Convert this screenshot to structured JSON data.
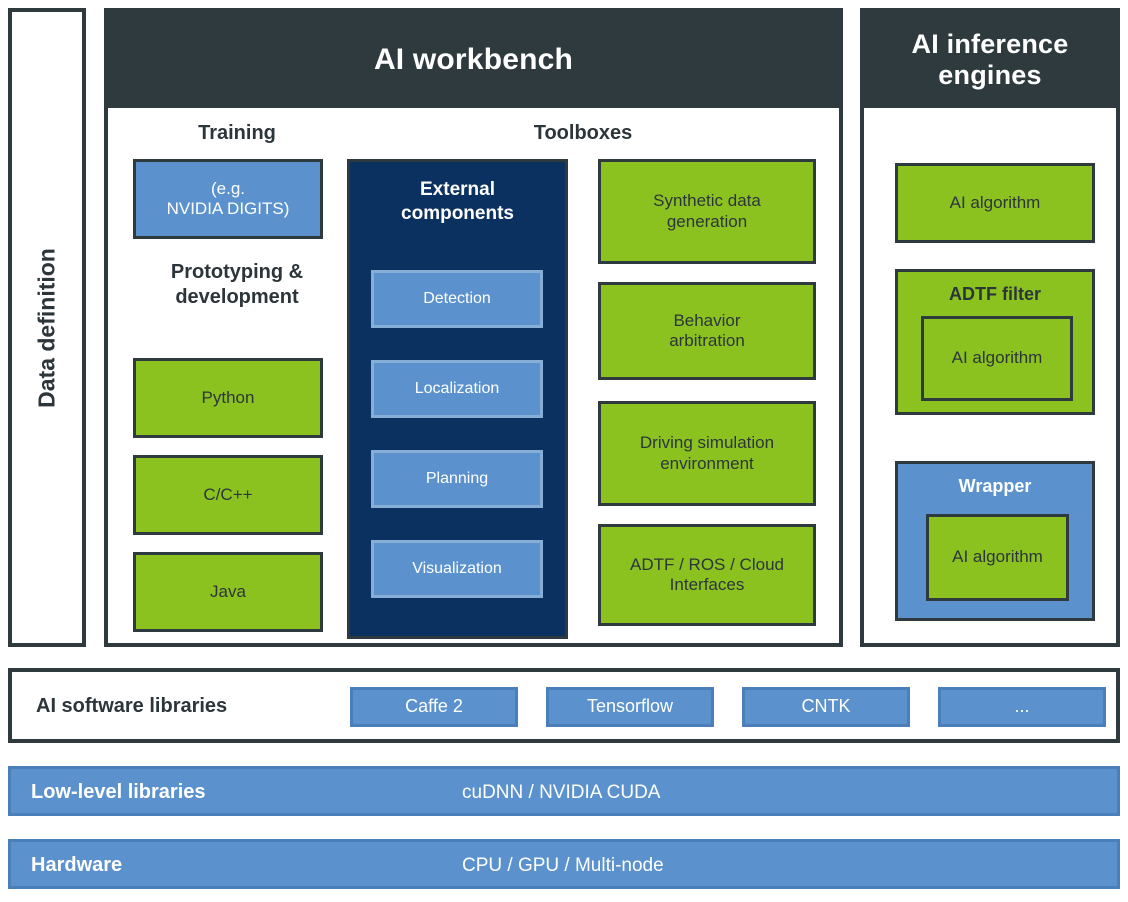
{
  "colors": {
    "dark": "#2e3a3e",
    "navy": "#0b3161",
    "blue": "#5b92ce",
    "green": "#8cc220",
    "white": "#ffffff"
  },
  "data_definition": {
    "label": "Data definition"
  },
  "workbench": {
    "title": "AI workbench",
    "training": {
      "title": "Training",
      "framework_box": "(e.g.\nNVIDIA DIGITS)",
      "framework_line1": "(e.g.",
      "framework_line2": "NVIDIA DIGITS)",
      "prototyping_title_line1": "Prototyping &",
      "prototyping_title_line2": "development",
      "languages": [
        "Python",
        "C/C++",
        "Java"
      ]
    },
    "toolboxes": {
      "title": "Toolboxes",
      "external_components": {
        "title_line1": "External",
        "title_line2": "components",
        "items": [
          "Detection",
          "Localization",
          "Planning",
          "Visualization"
        ]
      },
      "modules": [
        {
          "line1": "Synthetic data",
          "line2": "generation"
        },
        {
          "line1": "Behavior",
          "line2": "arbitration"
        },
        {
          "line1": "Driving simulation",
          "line2": "environment"
        },
        {
          "line1": "ADTF / ROS / Cloud",
          "line2": "Interfaces"
        }
      ]
    }
  },
  "inference": {
    "title_line1": "AI inference",
    "title_line2": "engines",
    "plain_algorithm": "AI algorithm",
    "adtf_filter": {
      "title": "ADTF filter",
      "inner": "AI algorithm"
    },
    "wrapper": {
      "title": "Wrapper",
      "inner": "AI algorithm"
    }
  },
  "software_libraries": {
    "label": "AI software libraries",
    "items": [
      "Caffe 2",
      "Tensorflow",
      "CNTK",
      "..."
    ]
  },
  "low_level_libraries": {
    "label": "Low-level libraries",
    "value": "cuDNN / NVIDIA CUDA"
  },
  "hardware": {
    "label": "Hardware",
    "value": "CPU / GPU / Multi-node"
  }
}
